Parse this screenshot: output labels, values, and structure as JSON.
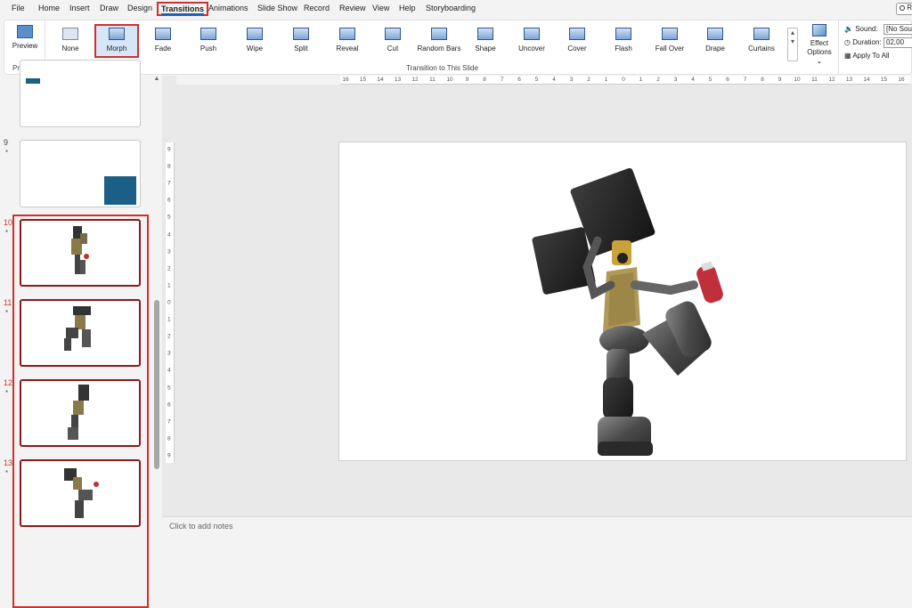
{
  "menu": {
    "items": [
      "File",
      "Home",
      "Insert",
      "Draw",
      "Design",
      "Transitions",
      "Animations",
      "Slide Show",
      "Record",
      "Review",
      "View",
      "Help",
      "Storyboarding"
    ],
    "active": "Transitions",
    "record_label": "Re"
  },
  "ribbon": {
    "preview": {
      "button_label": "Preview",
      "group_label": "Preview"
    },
    "transitions": [
      "None",
      "Morph",
      "Fade",
      "Push",
      "Wipe",
      "Split",
      "Reveal",
      "Cut",
      "Random Bars",
      "Shape",
      "Uncover",
      "Cover",
      "Flash",
      "Fall Over",
      "Drape",
      "Curtains"
    ],
    "selected_transition": "Morph",
    "group_label": "Transition to This Slide",
    "effect_options": {
      "line1": "Effect",
      "line2": "Options ⌄"
    },
    "timing": {
      "sound_label": "Sound:",
      "sound_value": "[No Sound]",
      "duration_label": "Duration:",
      "duration_value": "02,00",
      "apply_all": "Apply To All"
    }
  },
  "slides": [
    {
      "number": "9",
      "marker": "*"
    },
    {
      "number": "10",
      "marker": "*"
    },
    {
      "number": "11",
      "marker": "*"
    },
    {
      "number": "12",
      "marker": "*"
    },
    {
      "number": "13",
      "marker": "*"
    }
  ],
  "ruler": {
    "horizontal_ticks": [
      "16",
      "15",
      "14",
      "13",
      "12",
      "11",
      "10",
      "9",
      "8",
      "7",
      "6",
      "5",
      "4",
      "3",
      "2",
      "1",
      "0",
      "1",
      "2",
      "3",
      "4",
      "5",
      "6",
      "7",
      "8",
      "9",
      "10",
      "11",
      "12",
      "13",
      "14",
      "15",
      "16"
    ],
    "vertical_ticks": [
      "9",
      "8",
      "7",
      "6",
      "5",
      "4",
      "3",
      "2",
      "1",
      "0",
      "1",
      "2",
      "3",
      "4",
      "5",
      "6",
      "7",
      "8",
      "9"
    ]
  },
  "notes": {
    "placeholder": "Click to add notes"
  },
  "colors": {
    "accent_red": "#d32f2f",
    "slide_blue": "#1b5f86",
    "thumb_border_selected": "#8b1a1a"
  }
}
